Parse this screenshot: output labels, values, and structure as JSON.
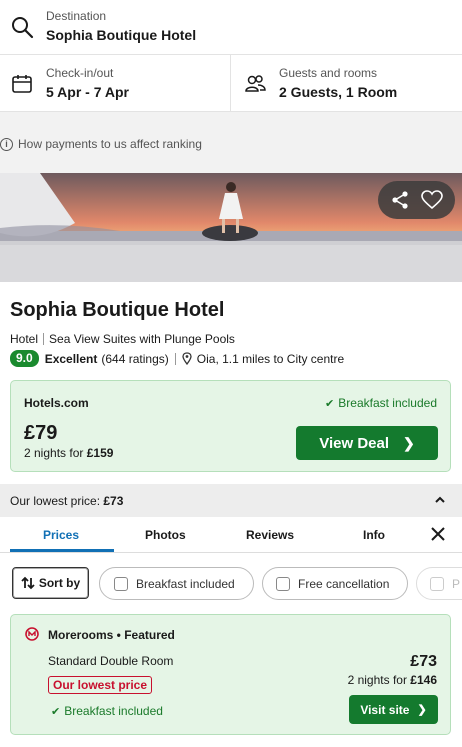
{
  "search": {
    "destination_label": "Destination",
    "destination_value": "Sophia Boutique Hotel",
    "checkin_label": "Check-in/out",
    "checkin_value": "5 Apr - 7 Apr",
    "guests_label": "Guests and rooms",
    "guests_value": "2 Guests, 1 Room"
  },
  "info_link": "How payments to us affect ranking",
  "hotel": {
    "name": "Sophia Boutique Hotel",
    "type": "Hotel",
    "tagline": "Sea View Suites with Plunge Pools",
    "score": "9.0",
    "rating_word": "Excellent",
    "rating_count": "(644 ratings)",
    "location": "Oia, 1.1 miles to City centre"
  },
  "top_deal": {
    "provider": "Hotels.com",
    "breakfast": "Breakfast included",
    "price": "£79",
    "nights_prefix": "2 nights for",
    "nights_total": "£159",
    "button": "View Deal"
  },
  "lowest": {
    "label": "Our lowest price:",
    "price": "£73"
  },
  "tabs": [
    "Prices",
    "Photos",
    "Reviews",
    "Info"
  ],
  "filters": {
    "sort": "Sort by",
    "chips": [
      "Breakfast included",
      "Free cancellation",
      "P"
    ]
  },
  "offer": {
    "provider": "Morerooms • Featured",
    "room": "Standard Double Room",
    "badge": "Our lowest price",
    "breakfast": "Breakfast included",
    "price": "£73",
    "nights_prefix": "2 nights for",
    "nights_total": "£146",
    "button": "Visit site"
  },
  "colors": {
    "accent_blue": "#1170b5",
    "deal_green": "#147a2e",
    "deal_bg": "#e5f5e6",
    "badge_red": "#c8102e"
  }
}
